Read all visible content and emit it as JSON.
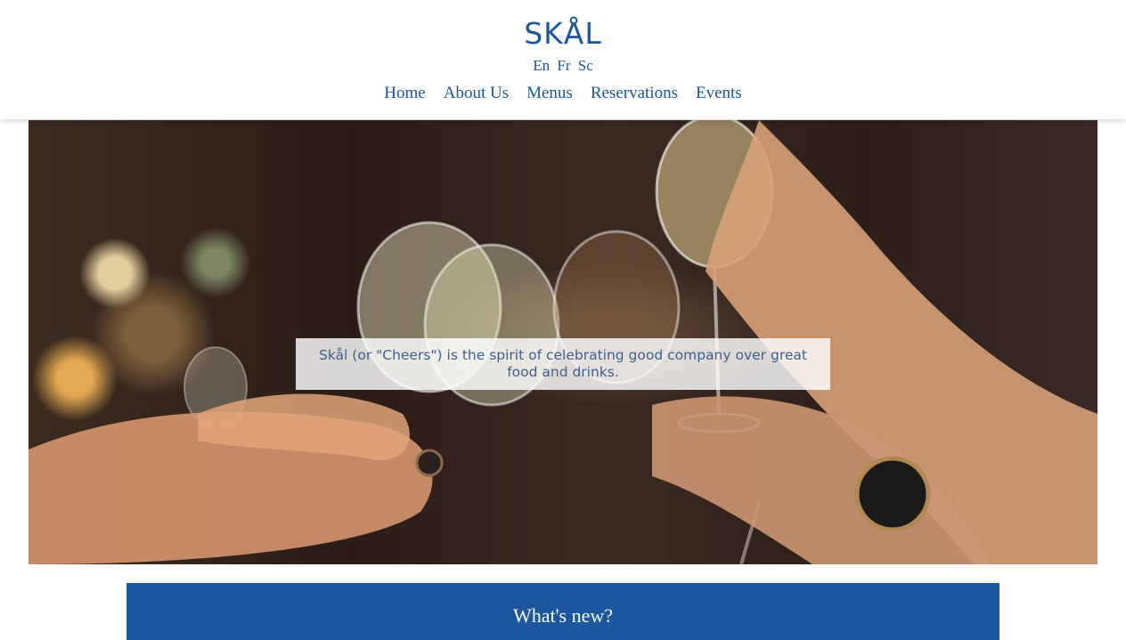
{
  "header": {
    "logo": "SKÅL",
    "languages": [
      "En",
      "Fr",
      "Sc"
    ],
    "nav": [
      "Home",
      "About Us",
      "Menus",
      "Reservations",
      "Events"
    ]
  },
  "hero": {
    "caption": "Skål (or \"Cheers\") is the spirit of celebrating good company over great food and drinks.",
    "image": "people-toasting-wine-glasses-photo"
  },
  "news": {
    "title": "What's new?"
  },
  "colors": {
    "brand": "#1d56a0",
    "background": "#ffffff",
    "caption_text": "#3f5f8f"
  }
}
